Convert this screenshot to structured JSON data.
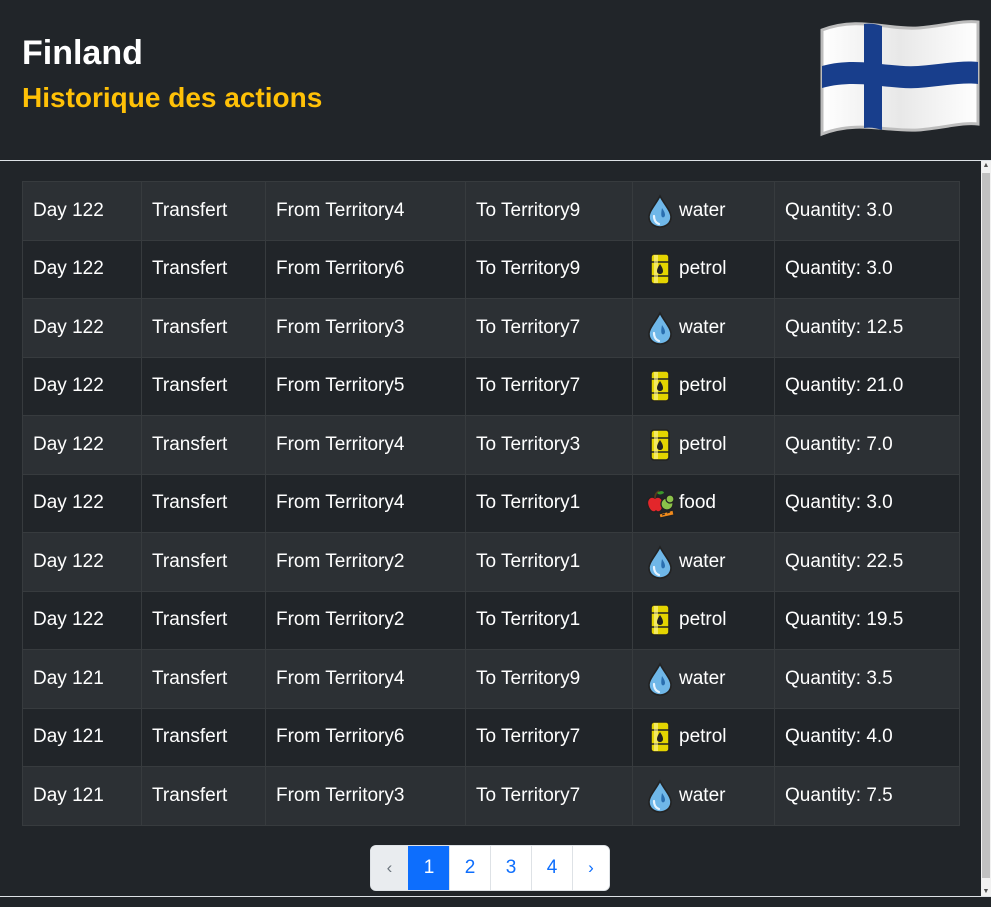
{
  "header": {
    "country": "Finland",
    "subtitle": "Historique des actions"
  },
  "colors": {
    "accent": "#ffc107",
    "background": "#212529",
    "row_striped": "#2c3034",
    "pagination_active": "#0d6efd",
    "flag_blue": "#183e8c"
  },
  "actions": [
    {
      "day": "Day 122",
      "type": "Transfert",
      "from": "From Territory4",
      "to": "To Territory9",
      "resource": "water",
      "icon": "water-drop-icon",
      "quantity": "Quantity: 3.0"
    },
    {
      "day": "Day 122",
      "type": "Transfert",
      "from": "From Territory6",
      "to": "To Territory9",
      "resource": "petrol",
      "icon": "oil-barrel-icon",
      "quantity": "Quantity: 3.0"
    },
    {
      "day": "Day 122",
      "type": "Transfert",
      "from": "From Territory3",
      "to": "To Territory7",
      "resource": "water",
      "icon": "water-drop-icon",
      "quantity": "Quantity: 12.5"
    },
    {
      "day": "Day 122",
      "type": "Transfert",
      "from": "From Territory5",
      "to": "To Territory7",
      "resource": "petrol",
      "icon": "oil-barrel-icon",
      "quantity": "Quantity: 21.0"
    },
    {
      "day": "Day 122",
      "type": "Transfert",
      "from": "From Territory4",
      "to": "To Territory3",
      "resource": "petrol",
      "icon": "oil-barrel-icon",
      "quantity": "Quantity: 7.0"
    },
    {
      "day": "Day 122",
      "type": "Transfert",
      "from": "From Territory4",
      "to": "To Territory1",
      "resource": "food",
      "icon": "food-icon",
      "quantity": "Quantity: 3.0"
    },
    {
      "day": "Day 122",
      "type": "Transfert",
      "from": "From Territory2",
      "to": "To Territory1",
      "resource": "water",
      "icon": "water-drop-icon",
      "quantity": "Quantity: 22.5"
    },
    {
      "day": "Day 122",
      "type": "Transfert",
      "from": "From Territory2",
      "to": "To Territory1",
      "resource": "petrol",
      "icon": "oil-barrel-icon",
      "quantity": "Quantity: 19.5"
    },
    {
      "day": "Day 121",
      "type": "Transfert",
      "from": "From Territory4",
      "to": "To Territory9",
      "resource": "water",
      "icon": "water-drop-icon",
      "quantity": "Quantity: 3.5"
    },
    {
      "day": "Day 121",
      "type": "Transfert",
      "from": "From Territory6",
      "to": "To Territory7",
      "resource": "petrol",
      "icon": "oil-barrel-icon",
      "quantity": "Quantity: 4.0"
    },
    {
      "day": "Day 121",
      "type": "Transfert",
      "from": "From Territory3",
      "to": "To Territory7",
      "resource": "water",
      "icon": "water-drop-icon",
      "quantity": "Quantity: 7.5"
    }
  ],
  "pagination": {
    "prev": "‹",
    "pages": [
      "1",
      "2",
      "3",
      "4"
    ],
    "active": "1",
    "next": "›"
  }
}
